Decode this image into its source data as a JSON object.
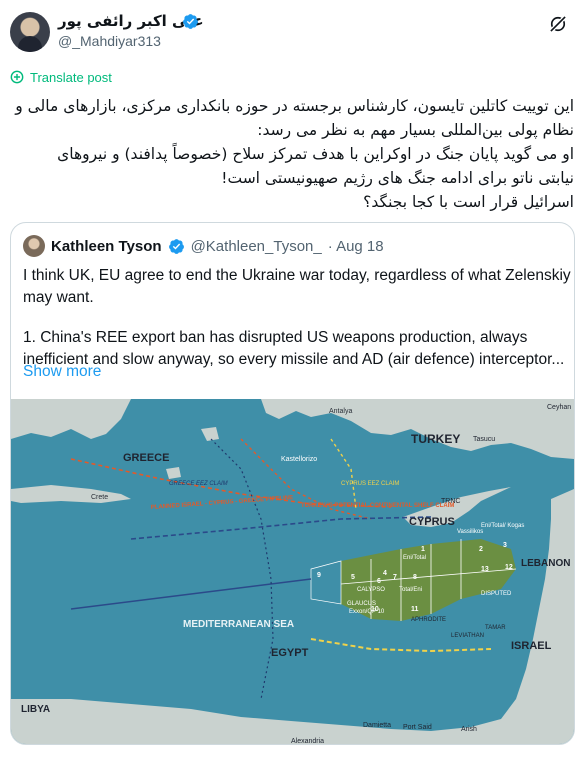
{
  "post": {
    "author_name": "علی اکبر رائفی پور",
    "author_handle": "@_Mahdiyar313",
    "translate_label": "Translate post",
    "lines": [
      "این توییت کاتلین تایسون، کارشناس برجسته در حوزه بانکداری مرکزی، بازارهای مالی و",
      "نظام پولی بین‌المللی بسیار مهم به نظر می رسد:",
      "او می گوید پایان جنگ در اوکراین با هدف تمرکز سلاح (خصوصاً پدافند) و نیروهای",
      "نیابتی ناتو برای ادامه جنگ های رژیم صهیونیستی است!",
      "اسرائیل قرار است با کجا بجنگد؟"
    ]
  },
  "quote": {
    "name": "Kathleen Tyson",
    "handle": "@Kathleen_Tyson_",
    "date": "· Aug 18",
    "line1": "I think UK, EU agree to end the Ukraine war today, regardless of what Zelenskiy",
    "line2": "may want.",
    "line3": "1. China's REE export ban has disrupted US weapons production, always",
    "line4": "inefficient and slow anyway, so every missile and AD (air defence) interceptor...",
    "show_more": "Show more"
  },
  "map": {
    "labels": {
      "greece": "GREECE",
      "turkey": "TURKEY",
      "cyprus": "CYPRUS",
      "lebanon": "LEBANON",
      "israel": "ISRAEL",
      "egypt": "EGYPT",
      "libya": "LIBYA",
      "med_sea": "MEDITERRANEAN SEA",
      "antalya": "Antalya",
      "kastellorizo": "Kastellorizo",
      "crete": "Crete",
      "trnc": "TRNC",
      "greece_eez": "GREECE EEZ CLAIM",
      "turkey_shelf": "TURKEY 'S POTENTIAL CONTINENTAL SHELF CLAIM",
      "pipeline": "PLANNED ISRAEL - CYPRUS - GREECE PIPELINE",
      "cyprus_claim": "CYPRUS EEZ CLAIM",
      "aphrodite": "APHRODITE",
      "leviathan": "LEVIATHAN",
      "tamar": "TAMAR",
      "calypso": "CALYPSO",
      "glaucus": "GLAUCUS",
      "damietta": "Damietta",
      "port_said": "Port Said",
      "alexandria": "Alexandria",
      "arish": "Arish",
      "ceyhan": "Ceyhan",
      "tasucu": "Tasucu",
      "disputed": "DISPUTED",
      "eni_total": "Eni/Total",
      "exxon": "Exxon/QP 10",
      "kogas": "Eni/Total/ Kogas",
      "total_eni": "Total/Eni",
      "vassilikos": "Vassilikos"
    },
    "block_numbers": [
      "1",
      "2",
      "3",
      "4",
      "5",
      "6",
      "7",
      "8",
      "9",
      "10",
      "11",
      "12",
      "13"
    ]
  }
}
